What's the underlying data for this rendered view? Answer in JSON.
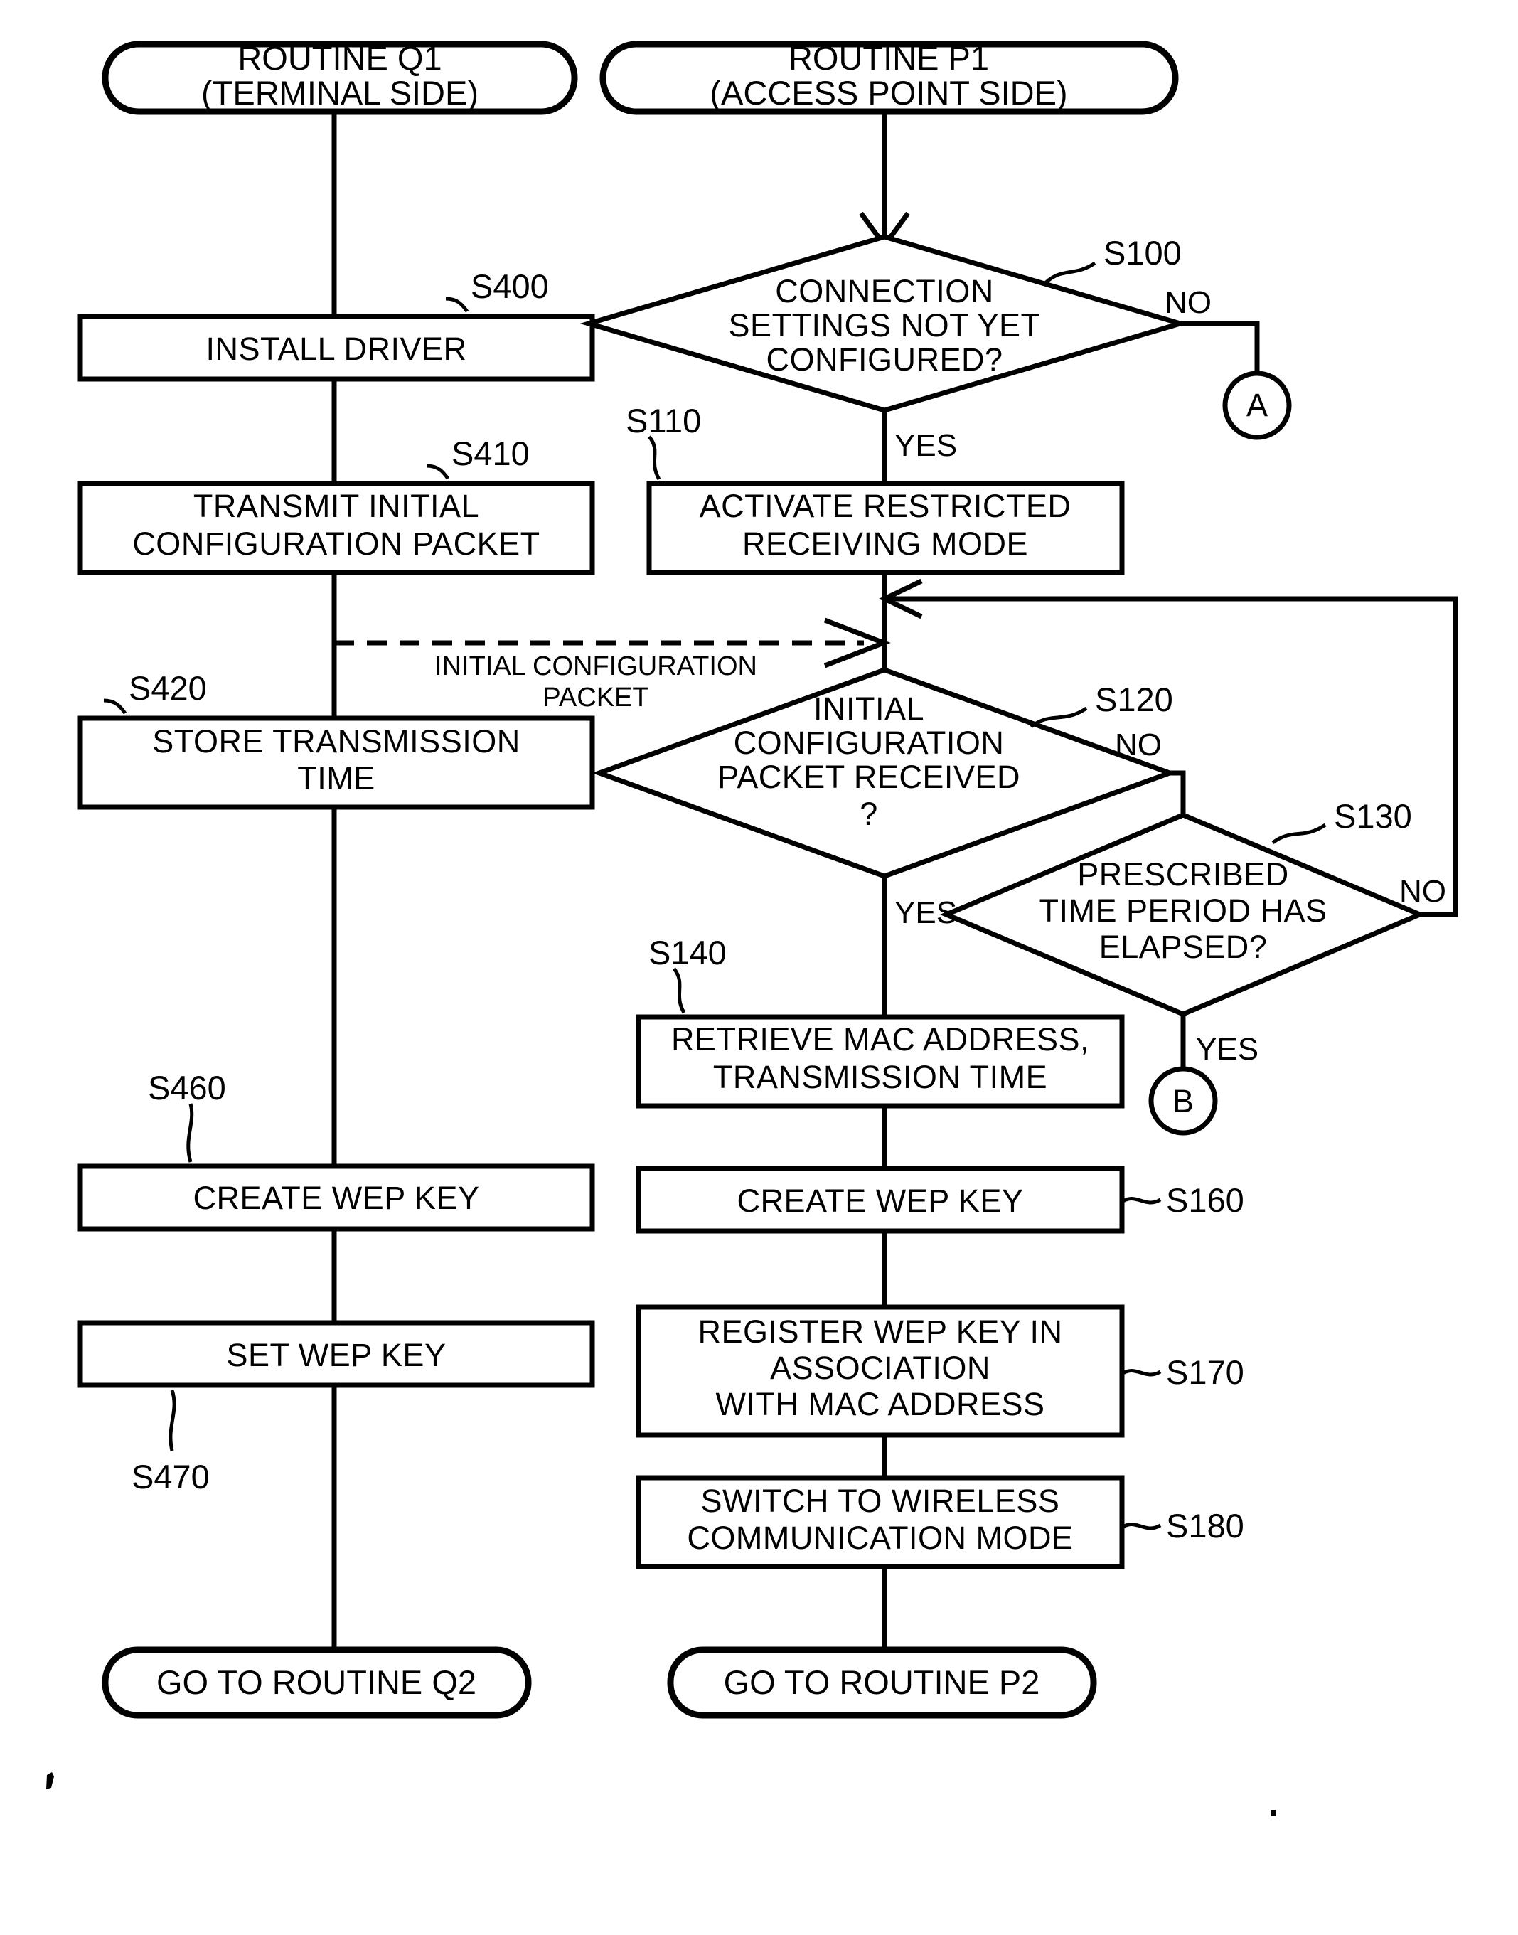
{
  "figure": {
    "type": "patent-flowchart",
    "columns": [
      {
        "id": "left",
        "title_line1": "ROUTINE Q1",
        "title_line2": "(TERMINAL SIDE)"
      },
      {
        "id": "right",
        "title_line1": "ROUTINE P1",
        "title_line2": "(ACCESS POINT SIDE)"
      }
    ],
    "terminals": {
      "start_left_line1": "ROUTINE Q1",
      "start_left_line2": "(TERMINAL SIDE)",
      "start_right_line1": "ROUTINE P1",
      "start_right_line2": "(ACCESS POINT SIDE)",
      "end_left": "GO TO ROUTINE Q2",
      "end_right": "GO TO ROUTINE P2"
    },
    "left_nodes": [
      {
        "step": "S400",
        "lines": [
          "INSTALL DRIVER"
        ]
      },
      {
        "step": "S410",
        "lines": [
          "TRANSMIT INITIAL",
          "CONFIGURATION PACKET"
        ]
      },
      {
        "step": "S420",
        "lines": [
          "STORE TRANSMISSION",
          "TIME"
        ]
      },
      {
        "step": "S460",
        "lines": [
          "CREATE WEP KEY"
        ]
      },
      {
        "step": "S470",
        "lines": [
          "SET WEP KEY"
        ]
      }
    ],
    "right_nodes": [
      {
        "step": "S100",
        "kind": "decision",
        "lines": [
          "CONNECTION",
          "SETTINGS NOT YET",
          "CONFIGURED?"
        ]
      },
      {
        "step": "S110",
        "kind": "process",
        "lines": [
          "ACTIVATE RESTRICTED",
          "RECEIVING MODE"
        ]
      },
      {
        "step": "S120",
        "kind": "decision",
        "lines": [
          "INITIAL",
          "CONFIGURATION",
          "PACKET RECEIVED",
          "?"
        ]
      },
      {
        "step": "S130",
        "kind": "decision",
        "lines": [
          "PRESCRIBED",
          "TIME PERIOD HAS",
          "ELAPSED?"
        ]
      },
      {
        "step": "S140",
        "kind": "process",
        "lines": [
          "RETRIEVE MAC ADDRESS,",
          "TRANSMISSION TIME"
        ]
      },
      {
        "step": "S160",
        "kind": "process",
        "lines": [
          "CREATE WEP KEY"
        ]
      },
      {
        "step": "S170",
        "kind": "process",
        "lines": [
          "REGISTER WEP KEY IN",
          "ASSOCIATION",
          "WITH MAC ADDRESS"
        ]
      },
      {
        "step": "S180",
        "kind": "process",
        "lines": [
          "SWITCH TO WIRELESS",
          "COMMUNICATION MODE"
        ]
      }
    ],
    "edge_labels": {
      "s100_no": "NO",
      "s100_yes": "YES",
      "s120_no": "NO",
      "s120_yes": "YES",
      "s130_no": "NO",
      "s130_yes": "YES",
      "packet_line1": "INITIAL CONFIGURATION",
      "packet_line2": "PACKET"
    },
    "connectors": [
      {
        "id": "A",
        "label": "A"
      },
      {
        "id": "B",
        "label": "B"
      }
    ],
    "step_labels": {
      "s100": "S100",
      "s110": "S110",
      "s120": "S120",
      "s130": "S130",
      "s140": "S140",
      "s160": "S160",
      "s170": "S170",
      "s180": "S180",
      "s400": "S400",
      "s410": "S410",
      "s420": "S420",
      "s460": "S460",
      "s470": "S470"
    },
    "colors": {
      "ink": "#000000",
      "paper": "#ffffff"
    }
  }
}
